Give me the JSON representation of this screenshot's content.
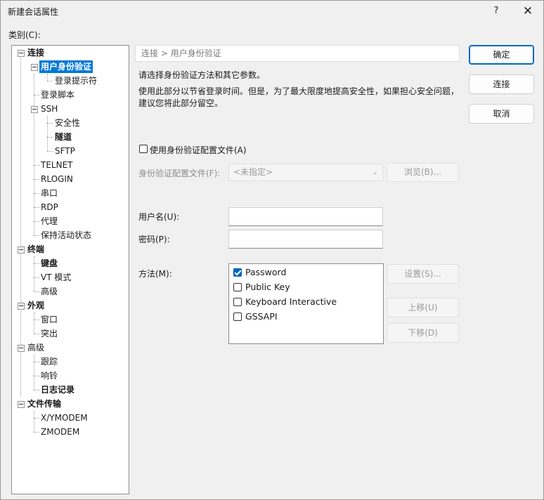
{
  "window": {
    "title": "新建会话属性",
    "help_label": "?",
    "close_label": "✕"
  },
  "category_label": "类别(C):",
  "tree": {
    "items": [
      "连接",
      "用户身份验证",
      "登录提示符",
      "登录脚本",
      "SSH",
      "安全性",
      "隧道",
      "SFTP",
      "TELNET",
      "RLOGIN",
      "串口",
      "RDP",
      "代理",
      "保持活动状态",
      "终端",
      "键盘",
      "VT 模式",
      "高级",
      "外观",
      "窗口",
      "突出",
      "高级",
      "跟踪",
      "响铃",
      "日志记录",
      "文件传输",
      "X/YMODEM",
      "ZMODEM"
    ],
    "selected": "用户身份验证"
  },
  "breadcrumb": "连接 > 用户身份验证",
  "description": {
    "line1": "请选择身份验证方法和其它参数。",
    "line2": "使用此部分以节省登录时间。但是，为了最大限度地提高安全性，如果担心安全问题，",
    "line3": "建议您将此部分留空。"
  },
  "profile": {
    "checkbox_label": "使用身份验证配置文件(A)",
    "checked": false,
    "file_label": "身份验证配置文件(F):",
    "file_value": "<未指定>",
    "browse_label": "浏览(B)..."
  },
  "credentials": {
    "username_label": "用户名(U):",
    "username_value": "",
    "password_label": "密码(P):",
    "password_value": ""
  },
  "method": {
    "label": "方法(M):",
    "options": [
      {
        "label": "Password",
        "checked": true
      },
      {
        "label": "Public Key",
        "checked": false
      },
      {
        "label": "Keyboard Interactive",
        "checked": false
      },
      {
        "label": "GSSAPI",
        "checked": false
      }
    ],
    "settings_label": "设置(S)...",
    "up_label": "上移(U)",
    "down_label": "下移(D)"
  },
  "buttons": {
    "ok": "确定",
    "connect": "连接",
    "cancel": "取消"
  },
  "colors": {
    "selection": "#0078d7",
    "primary_border": "#0067c0",
    "background": "#f0f0f0"
  }
}
